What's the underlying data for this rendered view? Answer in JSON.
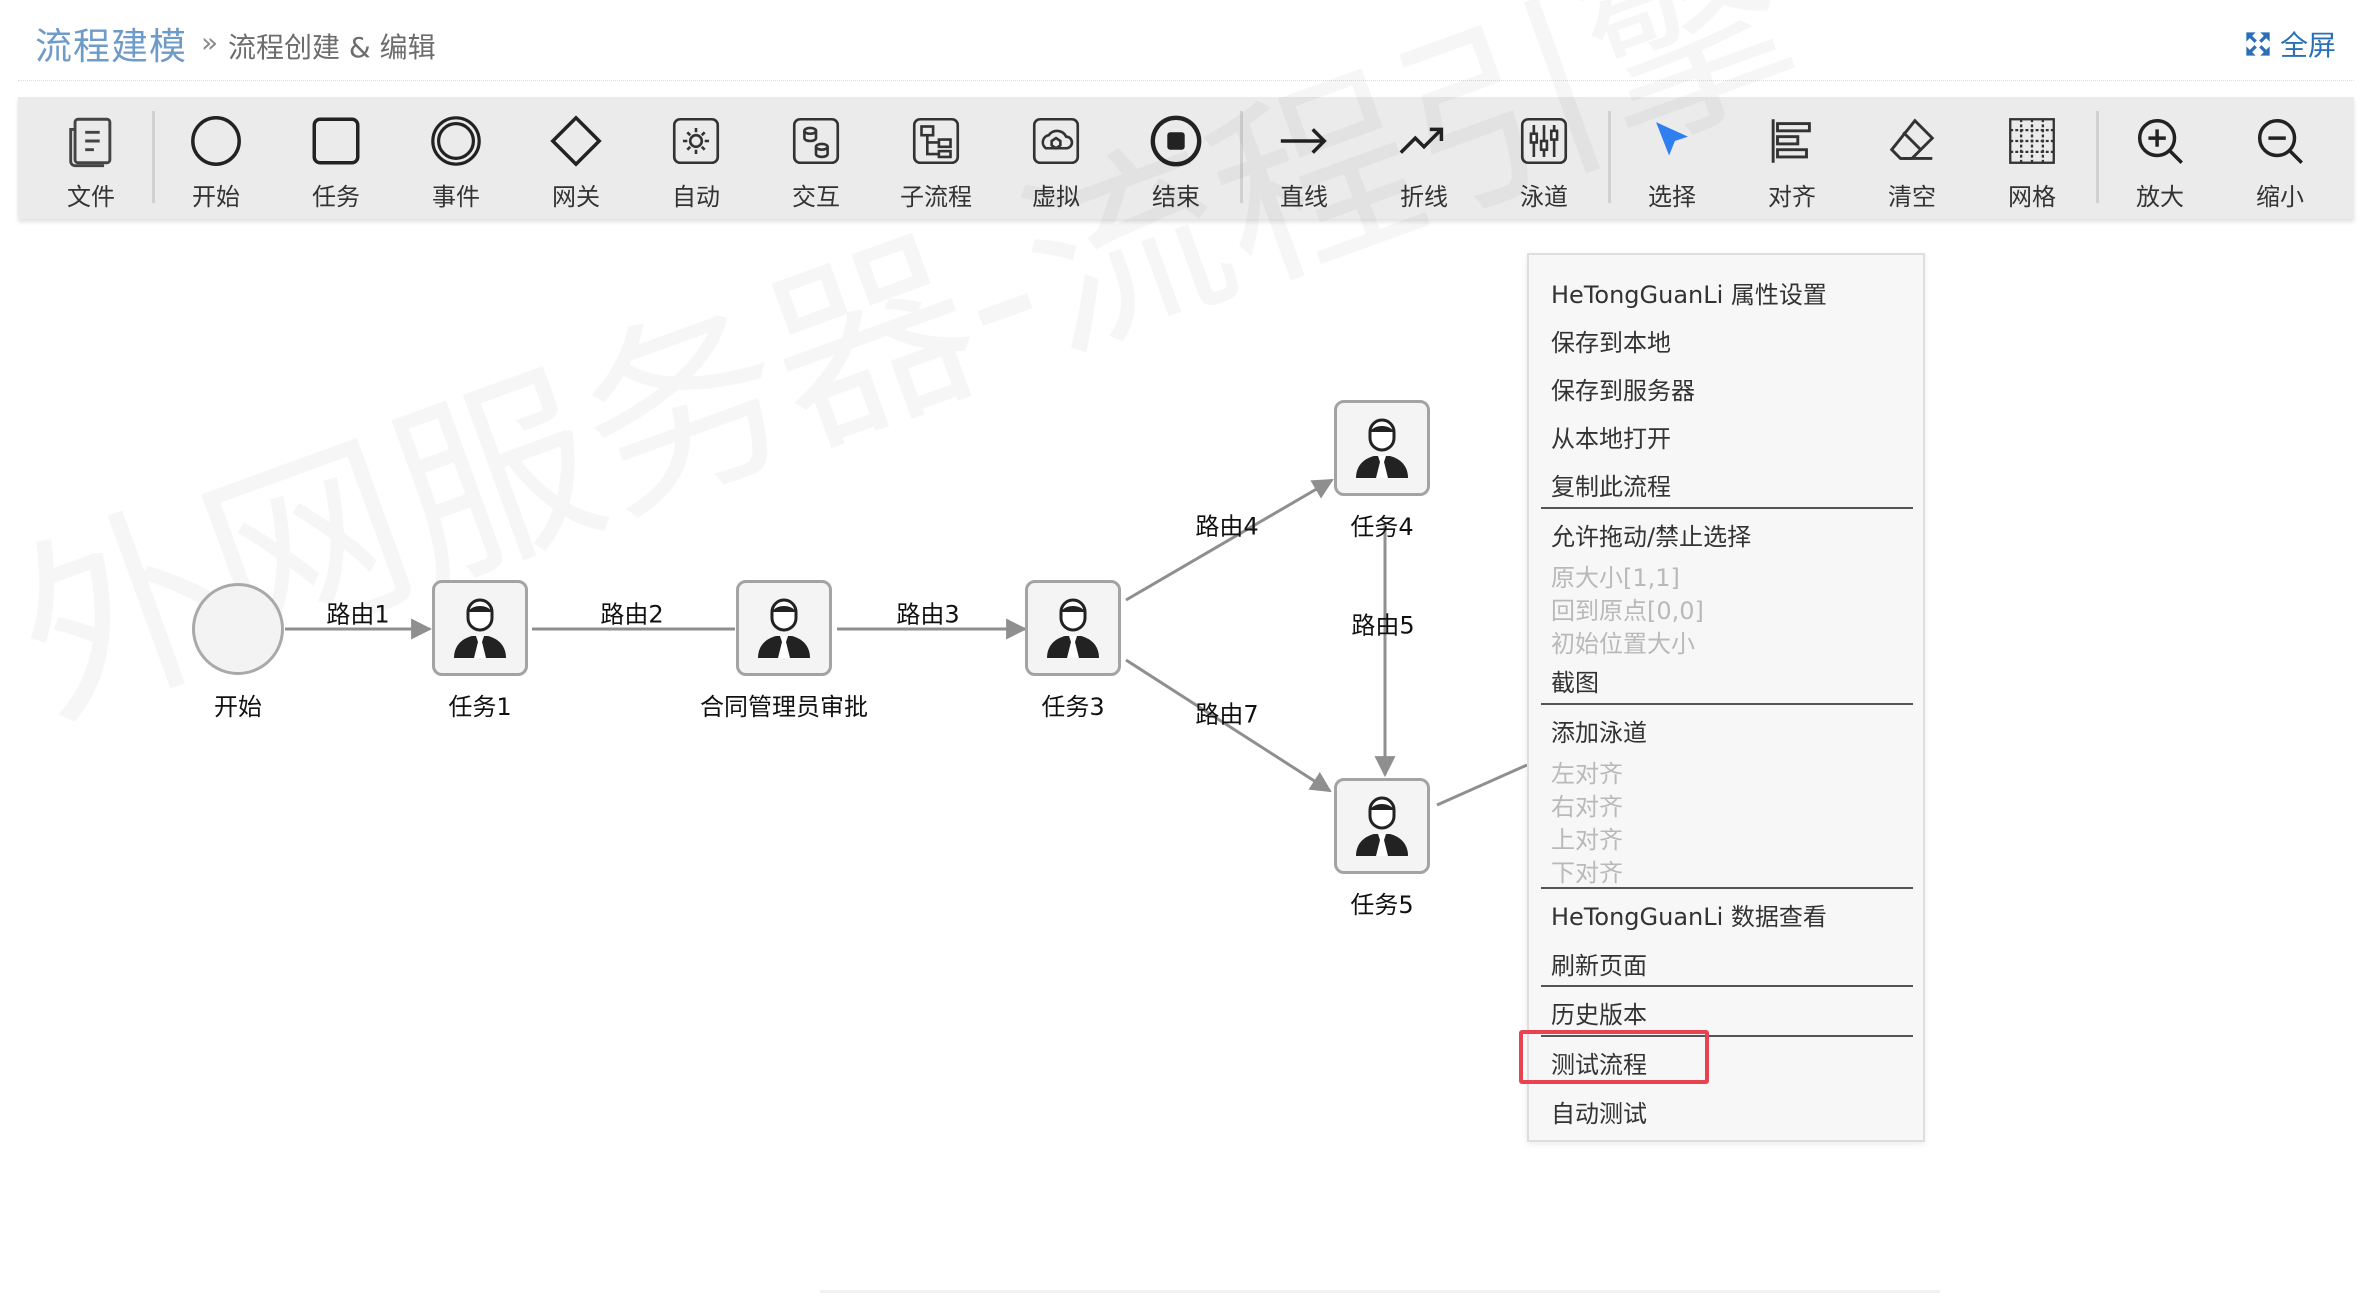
{
  "header": {
    "title": "流程建模",
    "crumb_sep": "»",
    "crumb": "流程创建 & 编辑",
    "fullscreen_label": "全屏"
  },
  "toolbar": {
    "tools": [
      {
        "label": "文件",
        "icon": "file-icon"
      },
      {
        "label": "开始",
        "icon": "start-event-icon"
      },
      {
        "label": "任务",
        "icon": "task-icon"
      },
      {
        "label": "事件",
        "icon": "event-icon"
      },
      {
        "label": "网关",
        "icon": "gateway-icon"
      },
      {
        "label": "自动",
        "icon": "auto-gear-icon"
      },
      {
        "label": "交互",
        "icon": "interaction-icon"
      },
      {
        "label": "子流程",
        "icon": "subprocess-icon"
      },
      {
        "label": "虚拟",
        "icon": "virtual-icon"
      },
      {
        "label": "结束",
        "icon": "end-event-icon"
      },
      {
        "label": "直线",
        "icon": "straight-line-icon"
      },
      {
        "label": "折线",
        "icon": "polyline-icon"
      },
      {
        "label": "泳道",
        "icon": "swimlane-icon"
      },
      {
        "label": "选择",
        "icon": "select-pointer-icon"
      },
      {
        "label": "对齐",
        "icon": "align-icon"
      },
      {
        "label": "清空",
        "icon": "eraser-icon"
      },
      {
        "label": "网格",
        "icon": "grid-icon"
      },
      {
        "label": "放大",
        "icon": "zoom-in-icon"
      },
      {
        "label": "缩小",
        "icon": "zoom-out-icon"
      }
    ]
  },
  "watermark": "外网服务器-流程引擎",
  "flow": {
    "nodes": {
      "start": "开始",
      "task1": "任务1",
      "approve": "合同管理员审批",
      "task3": "任务3",
      "task4": "任务4",
      "task5": "任务5"
    },
    "edges": {
      "r1": "路由1",
      "r2": "路由2",
      "r3": "路由3",
      "r4": "路由4",
      "r5": "路由5",
      "r7": "路由7"
    }
  },
  "context_menu": {
    "items": [
      {
        "label": "HeTongGuanLi 属性设置",
        "enabled": true
      },
      {
        "label": "保存到本地",
        "enabled": true
      },
      {
        "label": "保存到服务器",
        "enabled": true
      },
      {
        "label": "从本地打开",
        "enabled": true
      },
      {
        "label": "复制此流程",
        "enabled": true
      },
      {
        "label": "允许拖动/禁止选择",
        "enabled": true
      },
      {
        "label": "原大小[1,1]",
        "enabled": false
      },
      {
        "label": "回到原点[0,0]",
        "enabled": false
      },
      {
        "label": "初始位置大小",
        "enabled": false
      },
      {
        "label": "截图",
        "enabled": true
      },
      {
        "label": "添加泳道",
        "enabled": true
      },
      {
        "label": "左对齐",
        "enabled": false
      },
      {
        "label": "右对齐",
        "enabled": false
      },
      {
        "label": "上对齐",
        "enabled": false
      },
      {
        "label": "下对齐",
        "enabled": false
      },
      {
        "label": "HeTongGuanLi 数据查看",
        "enabled": true
      },
      {
        "label": "刷新页面",
        "enabled": true
      },
      {
        "label": "历史版本",
        "enabled": true
      },
      {
        "label": "测试流程",
        "enabled": true,
        "highlighted": true
      },
      {
        "label": "自动测试",
        "enabled": true
      }
    ]
  },
  "colors": {
    "title": "#6f9bc8",
    "link": "#2b6fb6",
    "highlight": "#e8434f",
    "select_pointer": "#2f7ff0"
  }
}
